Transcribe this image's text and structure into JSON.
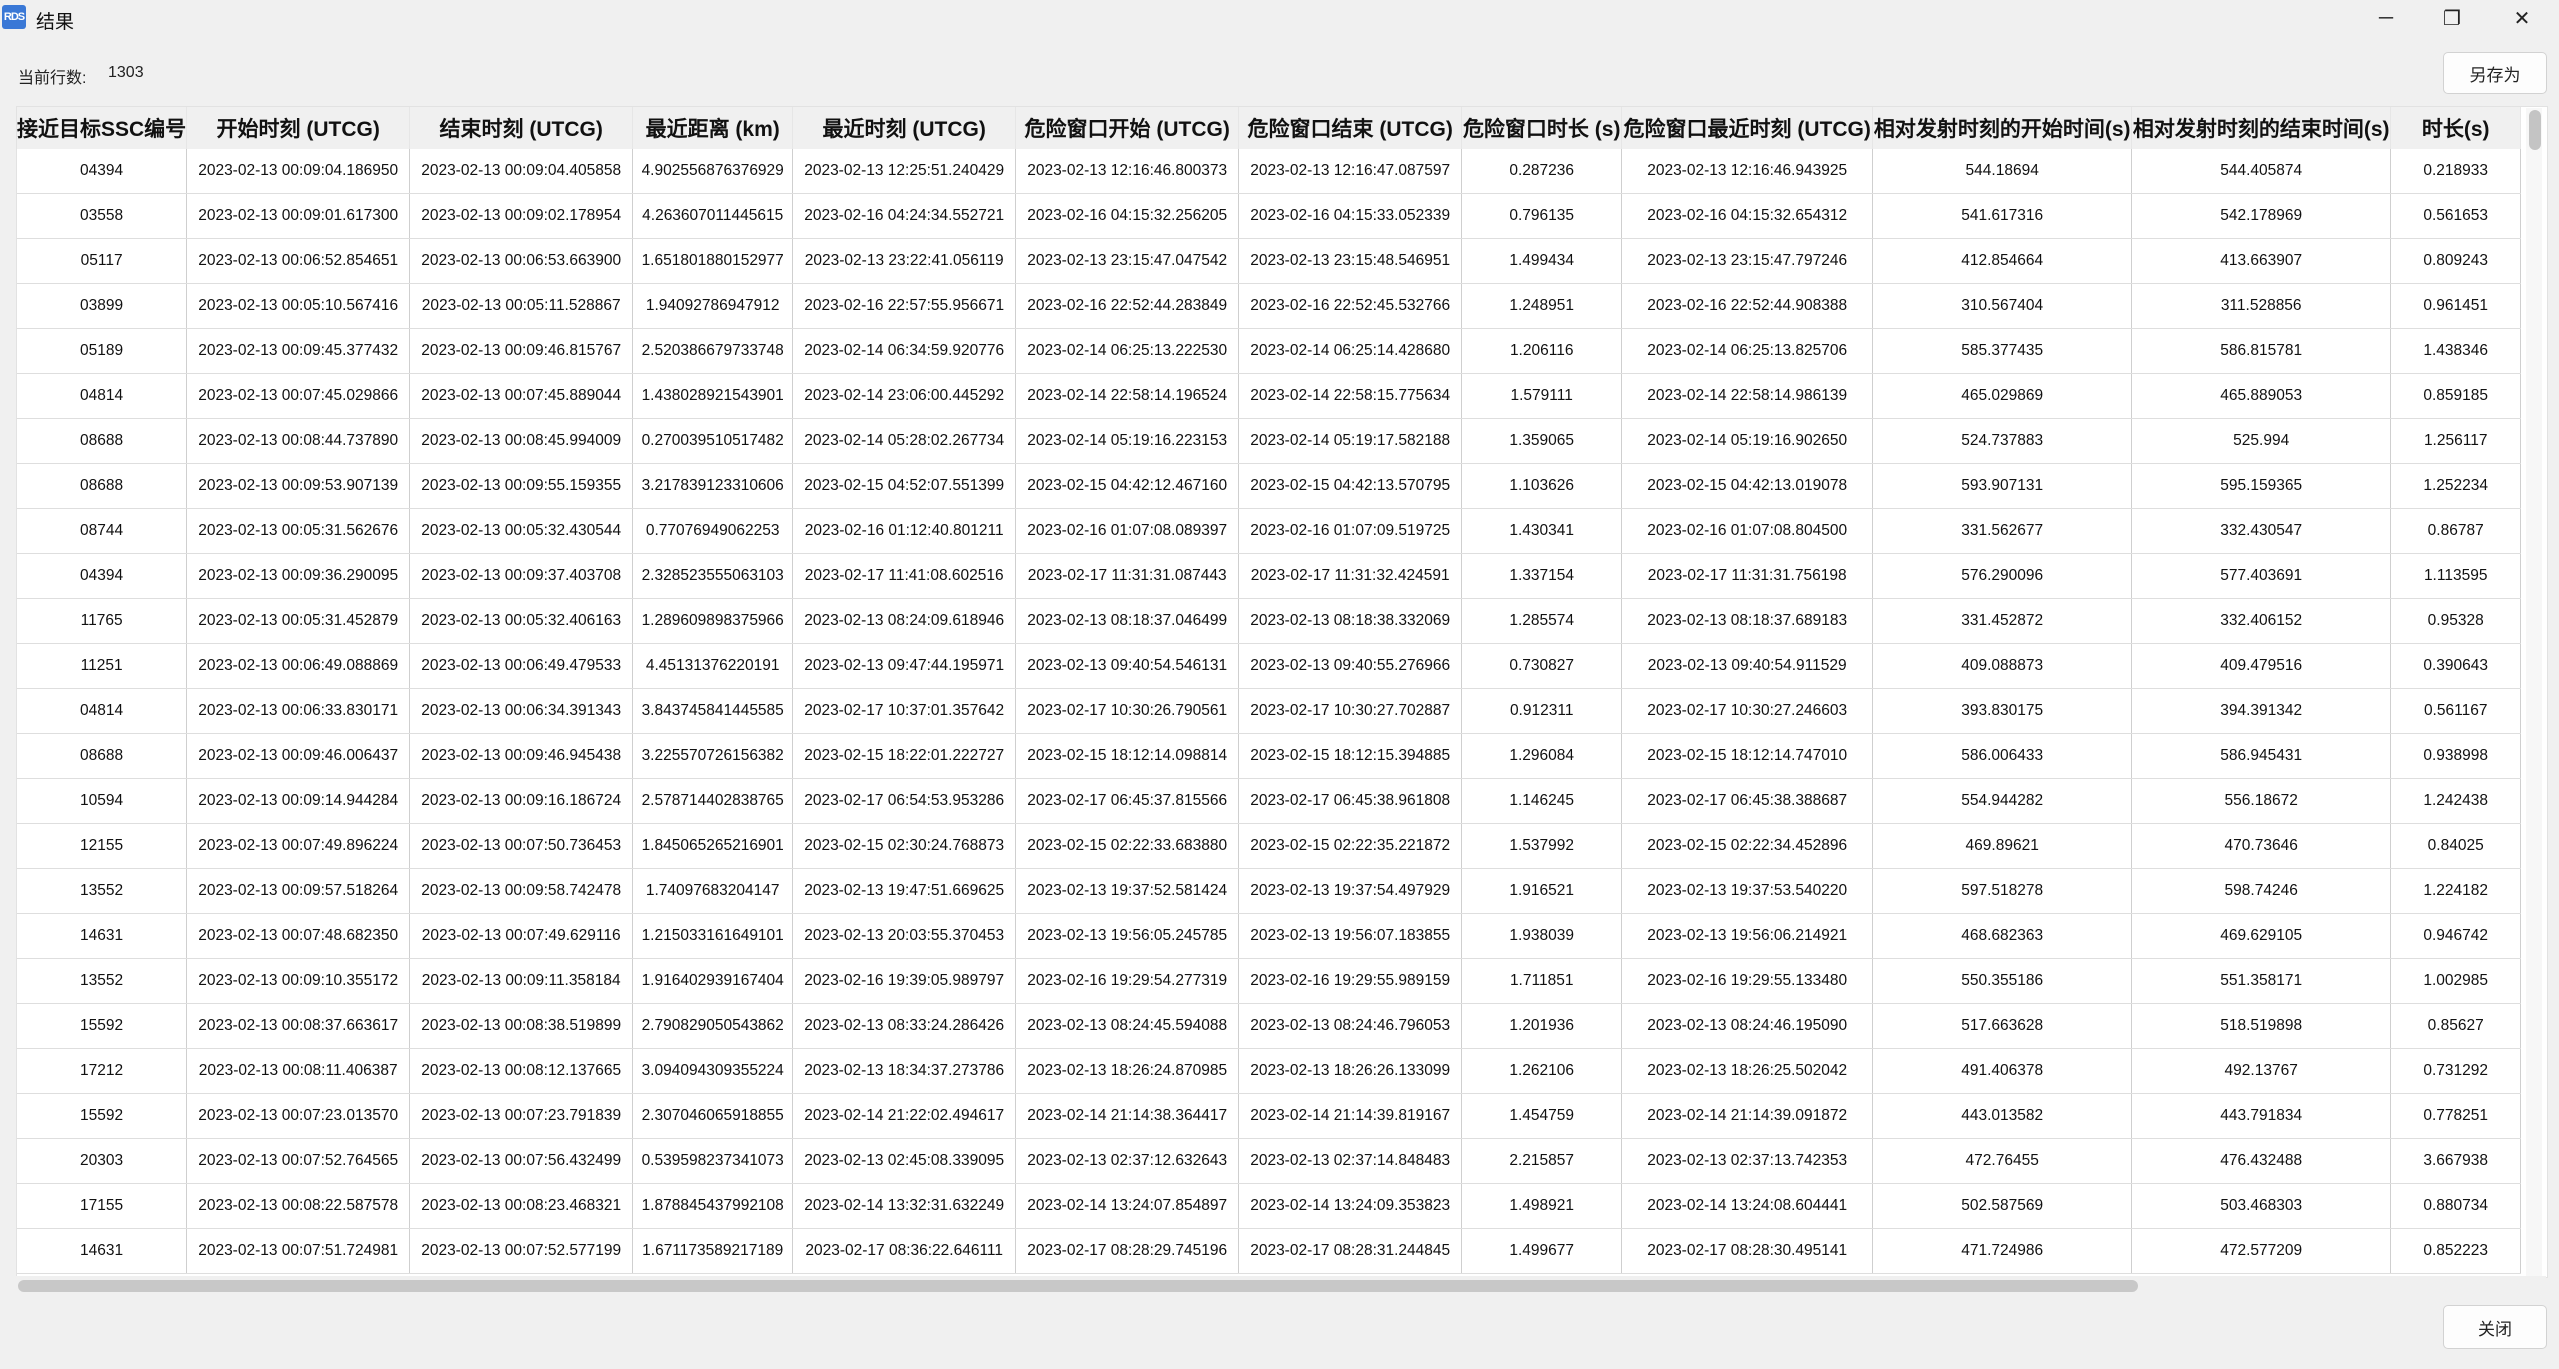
{
  "window": {
    "title": "结果",
    "icon_text": "RDS",
    "minimize_glyph": "─",
    "maximize_glyph": "❐",
    "close_glyph": "✕"
  },
  "toolbar": {
    "row_count_label": "当前行数:",
    "row_count_value": "1303",
    "save_as_label": "另存为"
  },
  "footer": {
    "close_label": "关闭"
  },
  "table": {
    "headers": [
      "接近目标SSC编号",
      "开始时刻 (UTCG)",
      "结束时刻 (UTCG)",
      "最近距离 (km)",
      "最近时刻 (UTCG)",
      "危险窗口开始 (UTCG)",
      "危险窗口结束 (UTCG)",
      "危险窗口时长 (s)",
      "危险窗口最近时刻 (UTCG)",
      "相对发射时刻的开始时间(s)",
      "相对发射时刻的结束时间(s)",
      "时长(s)"
    ],
    "rows": [
      [
        "04394",
        "2023-02-13 00:09:04.186950",
        "2023-02-13 00:09:04.405858",
        "4.902556876376929",
        "2023-02-13 12:25:51.240429",
        "2023-02-13 12:16:46.800373",
        "2023-02-13 12:16:47.087597",
        "0.287236",
        "2023-02-13 12:16:46.943925",
        "544.18694",
        "544.405874",
        "0.218933"
      ],
      [
        "03558",
        "2023-02-13 00:09:01.617300",
        "2023-02-13 00:09:02.178954",
        "4.263607011445615",
        "2023-02-16 04:24:34.552721",
        "2023-02-16 04:15:32.256205",
        "2023-02-16 04:15:33.052339",
        "0.796135",
        "2023-02-16 04:15:32.654312",
        "541.617316",
        "542.178969",
        "0.561653"
      ],
      [
        "05117",
        "2023-02-13 00:06:52.854651",
        "2023-02-13 00:06:53.663900",
        "1.651801880152977",
        "2023-02-13 23:22:41.056119",
        "2023-02-13 23:15:47.047542",
        "2023-02-13 23:15:48.546951",
        "1.499434",
        "2023-02-13 23:15:47.797246",
        "412.854664",
        "413.663907",
        "0.809243"
      ],
      [
        "03899",
        "2023-02-13 00:05:10.567416",
        "2023-02-13 00:05:11.528867",
        "1.94092786947912",
        "2023-02-16 22:57:55.956671",
        "2023-02-16 22:52:44.283849",
        "2023-02-16 22:52:45.532766",
        "1.248951",
        "2023-02-16 22:52:44.908388",
        "310.567404",
        "311.528856",
        "0.961451"
      ],
      [
        "05189",
        "2023-02-13 00:09:45.377432",
        "2023-02-13 00:09:46.815767",
        "2.520386679733748",
        "2023-02-14 06:34:59.920776",
        "2023-02-14 06:25:13.222530",
        "2023-02-14 06:25:14.428680",
        "1.206116",
        "2023-02-14 06:25:13.825706",
        "585.377435",
        "586.815781",
        "1.438346"
      ],
      [
        "04814",
        "2023-02-13 00:07:45.029866",
        "2023-02-13 00:07:45.889044",
        "1.438028921543901",
        "2023-02-14 23:06:00.445292",
        "2023-02-14 22:58:14.196524",
        "2023-02-14 22:58:15.775634",
        "1.579111",
        "2023-02-14 22:58:14.986139",
        "465.029869",
        "465.889053",
        "0.859185"
      ],
      [
        "08688",
        "2023-02-13 00:08:44.737890",
        "2023-02-13 00:08:45.994009",
        "0.270039510517482",
        "2023-02-14 05:28:02.267734",
        "2023-02-14 05:19:16.223153",
        "2023-02-14 05:19:17.582188",
        "1.359065",
        "2023-02-14 05:19:16.902650",
        "524.737883",
        "525.994",
        "1.256117"
      ],
      [
        "08688",
        "2023-02-13 00:09:53.907139",
        "2023-02-13 00:09:55.159355",
        "3.217839123310606",
        "2023-02-15 04:52:07.551399",
        "2023-02-15 04:42:12.467160",
        "2023-02-15 04:42:13.570795",
        "1.103626",
        "2023-02-15 04:42:13.019078",
        "593.907131",
        "595.159365",
        "1.252234"
      ],
      [
        "08744",
        "2023-02-13 00:05:31.562676",
        "2023-02-13 00:05:32.430544",
        "0.77076949062253",
        "2023-02-16 01:12:40.801211",
        "2023-02-16 01:07:08.089397",
        "2023-02-16 01:07:09.519725",
        "1.430341",
        "2023-02-16 01:07:08.804500",
        "331.562677",
        "332.430547",
        "0.86787"
      ],
      [
        "04394",
        "2023-02-13 00:09:36.290095",
        "2023-02-13 00:09:37.403708",
        "2.328523555063103",
        "2023-02-17 11:41:08.602516",
        "2023-02-17 11:31:31.087443",
        "2023-02-17 11:31:32.424591",
        "1.337154",
        "2023-02-17 11:31:31.756198",
        "576.290096",
        "577.403691",
        "1.113595"
      ],
      [
        "11765",
        "2023-02-13 00:05:31.452879",
        "2023-02-13 00:05:32.406163",
        "1.289609898375966",
        "2023-02-13 08:24:09.618946",
        "2023-02-13 08:18:37.046499",
        "2023-02-13 08:18:38.332069",
        "1.285574",
        "2023-02-13 08:18:37.689183",
        "331.452872",
        "332.406152",
        "0.95328"
      ],
      [
        "11251",
        "2023-02-13 00:06:49.088869",
        "2023-02-13 00:06:49.479533",
        "4.45131376220191",
        "2023-02-13 09:47:44.195971",
        "2023-02-13 09:40:54.546131",
        "2023-02-13 09:40:55.276966",
        "0.730827",
        "2023-02-13 09:40:54.911529",
        "409.088873",
        "409.479516",
        "0.390643"
      ],
      [
        "04814",
        "2023-02-13 00:06:33.830171",
        "2023-02-13 00:06:34.391343",
        "3.843745841445585",
        "2023-02-17 10:37:01.357642",
        "2023-02-17 10:30:26.790561",
        "2023-02-17 10:30:27.702887",
        "0.912311",
        "2023-02-17 10:30:27.246603",
        "393.830175",
        "394.391342",
        "0.561167"
      ],
      [
        "08688",
        "2023-02-13 00:09:46.006437",
        "2023-02-13 00:09:46.945438",
        "3.225570726156382",
        "2023-02-15 18:22:01.222727",
        "2023-02-15 18:12:14.098814",
        "2023-02-15 18:12:15.394885",
        "1.296084",
        "2023-02-15 18:12:14.747010",
        "586.006433",
        "586.945431",
        "0.938998"
      ],
      [
        "10594",
        "2023-02-13 00:09:14.944284",
        "2023-02-13 00:09:16.186724",
        "2.578714402838765",
        "2023-02-17 06:54:53.953286",
        "2023-02-17 06:45:37.815566",
        "2023-02-17 06:45:38.961808",
        "1.146245",
        "2023-02-17 06:45:38.388687",
        "554.944282",
        "556.18672",
        "1.242438"
      ],
      [
        "12155",
        "2023-02-13 00:07:49.896224",
        "2023-02-13 00:07:50.736453",
        "1.845065265216901",
        "2023-02-15 02:30:24.768873",
        "2023-02-15 02:22:33.683880",
        "2023-02-15 02:22:35.221872",
        "1.537992",
        "2023-02-15 02:22:34.452896",
        "469.89621",
        "470.73646",
        "0.84025"
      ],
      [
        "13552",
        "2023-02-13 00:09:57.518264",
        "2023-02-13 00:09:58.742478",
        "1.74097683204147",
        "2023-02-13 19:47:51.669625",
        "2023-02-13 19:37:52.581424",
        "2023-02-13 19:37:54.497929",
        "1.916521",
        "2023-02-13 19:37:53.540220",
        "597.518278",
        "598.74246",
        "1.224182"
      ],
      [
        "14631",
        "2023-02-13 00:07:48.682350",
        "2023-02-13 00:07:49.629116",
        "1.215033161649101",
        "2023-02-13 20:03:55.370453",
        "2023-02-13 19:56:05.245785",
        "2023-02-13 19:56:07.183855",
        "1.938039",
        "2023-02-13 19:56:06.214921",
        "468.682363",
        "469.629105",
        "0.946742"
      ],
      [
        "13552",
        "2023-02-13 00:09:10.355172",
        "2023-02-13 00:09:11.358184",
        "1.916402939167404",
        "2023-02-16 19:39:05.989797",
        "2023-02-16 19:29:54.277319",
        "2023-02-16 19:29:55.989159",
        "1.711851",
        "2023-02-16 19:29:55.133480",
        "550.355186",
        "551.358171",
        "1.002985"
      ],
      [
        "15592",
        "2023-02-13 00:08:37.663617",
        "2023-02-13 00:08:38.519899",
        "2.790829050543862",
        "2023-02-13 08:33:24.286426",
        "2023-02-13 08:24:45.594088",
        "2023-02-13 08:24:46.796053",
        "1.201936",
        "2023-02-13 08:24:46.195090",
        "517.663628",
        "518.519898",
        "0.85627"
      ],
      [
        "17212",
        "2023-02-13 00:08:11.406387",
        "2023-02-13 00:08:12.137665",
        "3.094094309355224",
        "2023-02-13 18:34:37.273786",
        "2023-02-13 18:26:24.870985",
        "2023-02-13 18:26:26.133099",
        "1.262106",
        "2023-02-13 18:26:25.502042",
        "491.406378",
        "492.13767",
        "0.731292"
      ],
      [
        "15592",
        "2023-02-13 00:07:23.013570",
        "2023-02-13 00:07:23.791839",
        "2.307046065918855",
        "2023-02-14 21:22:02.494617",
        "2023-02-14 21:14:38.364417",
        "2023-02-14 21:14:39.819167",
        "1.454759",
        "2023-02-14 21:14:39.091872",
        "443.013582",
        "443.791834",
        "0.778251"
      ],
      [
        "20303",
        "2023-02-13 00:07:52.764565",
        "2023-02-13 00:07:56.432499",
        "0.539598237341073",
        "2023-02-13 02:45:08.339095",
        "2023-02-13 02:37:12.632643",
        "2023-02-13 02:37:14.848483",
        "2.215857",
        "2023-02-13 02:37:13.742353",
        "472.76455",
        "476.432488",
        "3.667938"
      ],
      [
        "17155",
        "2023-02-13 00:08:22.587578",
        "2023-02-13 00:08:23.468321",
        "1.878845437992108",
        "2023-02-14 13:32:31.632249",
        "2023-02-14 13:24:07.854897",
        "2023-02-14 13:24:09.353823",
        "1.498921",
        "2023-02-14 13:24:08.604441",
        "502.587569",
        "503.468303",
        "0.880734"
      ],
      [
        "14631",
        "2023-02-13 00:07:51.724981",
        "2023-02-13 00:07:52.577199",
        "1.671173589217189",
        "2023-02-17 08:36:22.646111",
        "2023-02-17 08:28:29.745196",
        "2023-02-17 08:28:31.244845",
        "1.499677",
        "2023-02-17 08:28:30.495141",
        "471.724986",
        "472.577209",
        "0.852223"
      ]
    ]
  }
}
